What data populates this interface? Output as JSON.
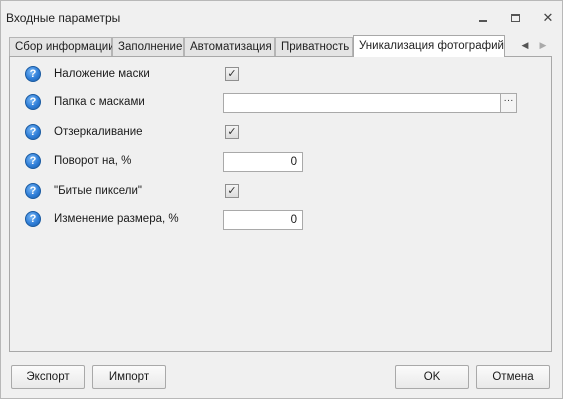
{
  "window": {
    "title": "Входные параметры"
  },
  "tabs": [
    {
      "label": "Сбор информации"
    },
    {
      "label": "Заполнение"
    },
    {
      "label": "Автоматизация"
    },
    {
      "label": "Приватность"
    },
    {
      "label": "Уникализация фотографий",
      "active": true
    }
  ],
  "fields": {
    "mask_overlay": {
      "label": "Наложение маски",
      "checked": true
    },
    "mask_folder": {
      "label": "Папка с масками",
      "value": "",
      "browse_label": "···"
    },
    "mirroring": {
      "label": "Отзеркаливание",
      "checked": true
    },
    "rotation": {
      "label": "Поворот на, %",
      "value": "0"
    },
    "dead_pixels": {
      "label": "\"Битые пиксели\"",
      "checked": true
    },
    "resize": {
      "label": "Изменение размера, %",
      "value": "0"
    }
  },
  "help_glyph": "?",
  "check_glyph": "✓",
  "buttons": {
    "export": "Экспорт",
    "import": "Импорт",
    "ok": "OK",
    "cancel": "Отмена"
  },
  "colors": {
    "accent_help": "#2f7ed8",
    "active_tab_bg": "#ffffff"
  }
}
